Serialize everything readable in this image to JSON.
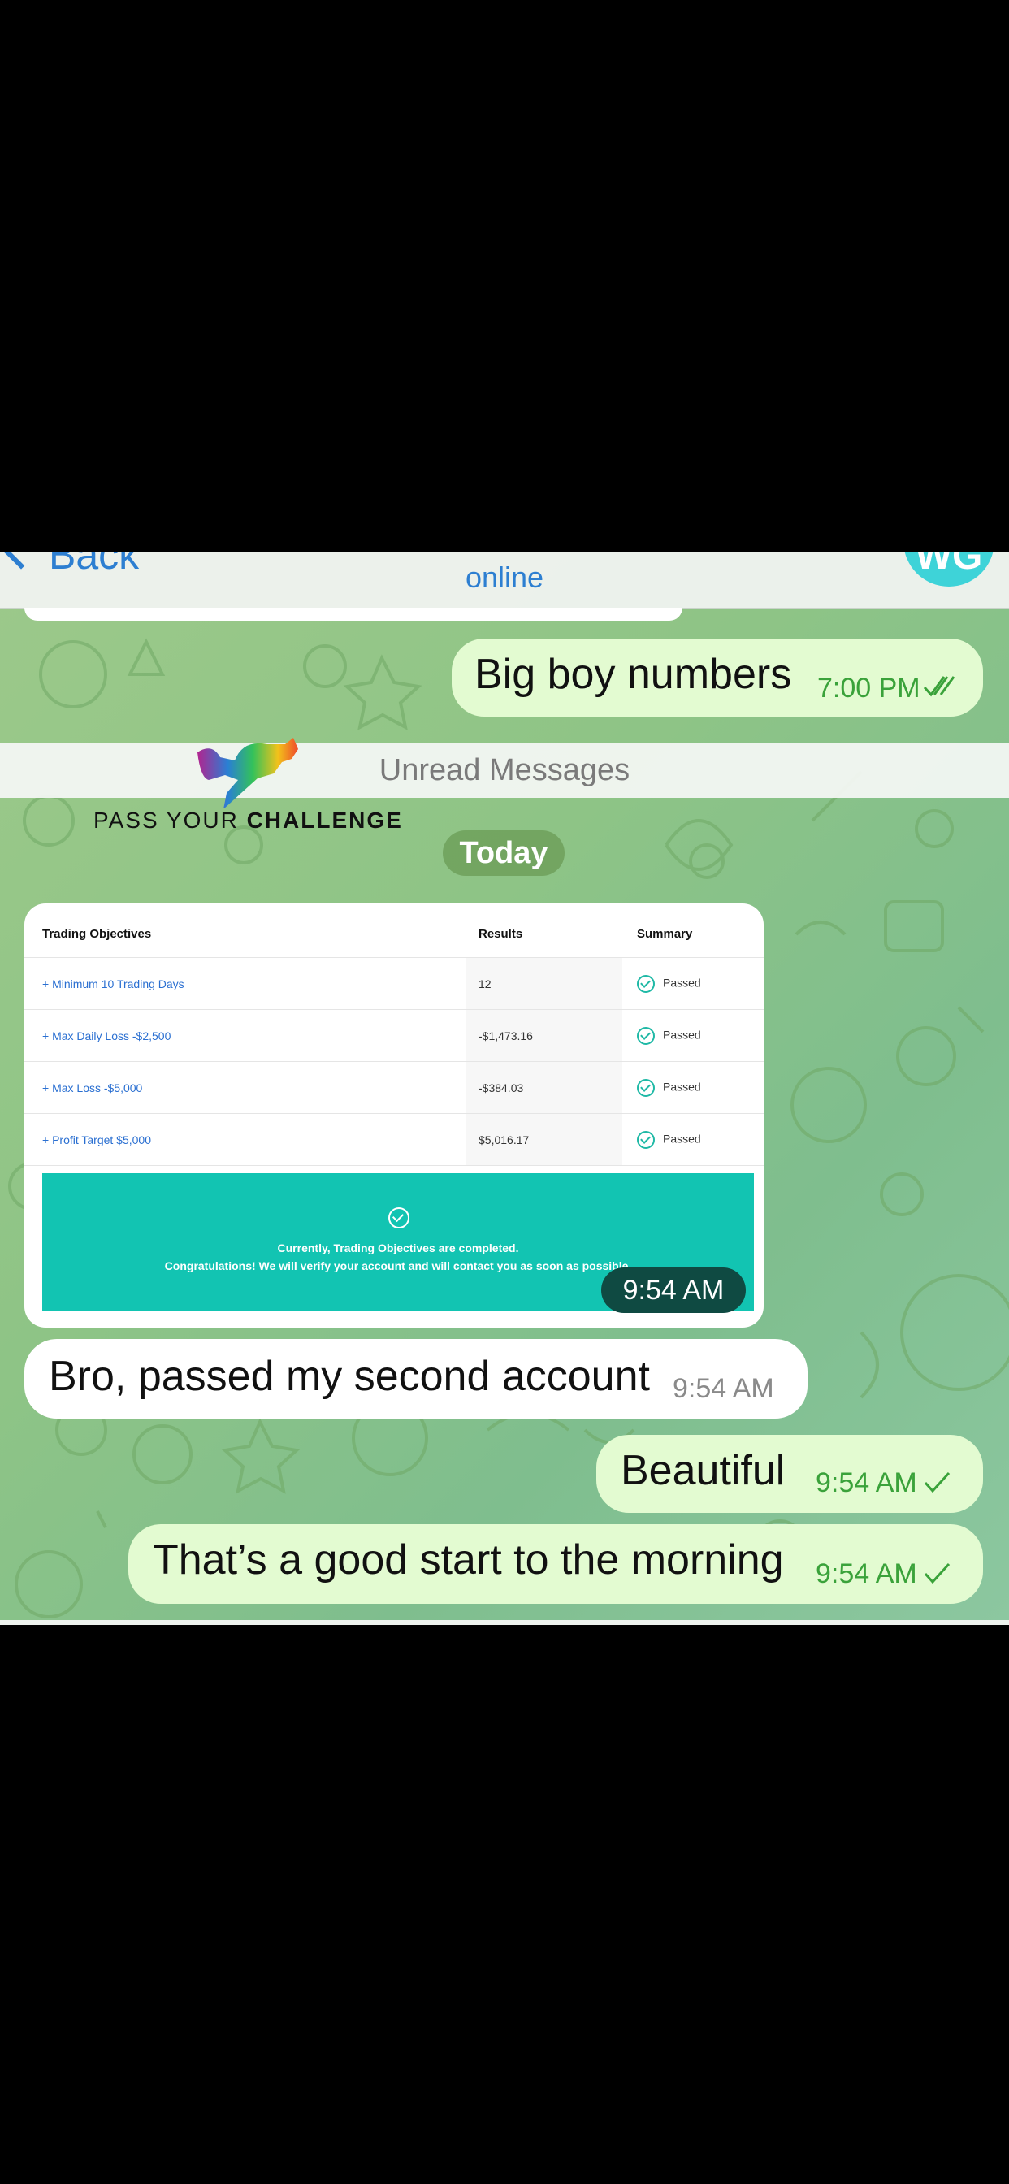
{
  "header": {
    "back_label": "Back",
    "status": "online",
    "avatar_initials": "WG"
  },
  "messages": {
    "m1": {
      "text": "Big boy numbers",
      "time": "7:00 PM",
      "status_icon": "double-check-icon"
    },
    "unread_label": "Unread Messages",
    "date_label": "Today",
    "image_time": "9:54 AM",
    "m2": {
      "text": "Bro, passed my second account",
      "time": "9:54 AM"
    },
    "m3": {
      "text": "Beautiful",
      "time": "9:54 AM",
      "status_icon": "check-icon"
    },
    "m4": {
      "text": "That’s a good start to the morning",
      "time": "9:54 AM",
      "status_icon": "check-icon"
    }
  },
  "logo": {
    "text_light": "PASS YOUR ",
    "text_bold": "CHALLENGE"
  },
  "trading_card": {
    "headers": {
      "objective": "Trading Objectives",
      "results": "Results",
      "summary": "Summary"
    },
    "rows": [
      {
        "objective": "+ Minimum 10 Trading Days",
        "result": "12",
        "summary": "Passed"
      },
      {
        "objective": "+ Max Daily Loss -$2,500",
        "result": "-$1,473.16",
        "summary": "Passed"
      },
      {
        "objective": "+ Max Loss -$5,000",
        "result": "-$384.03",
        "summary": "Passed"
      },
      {
        "objective": "+ Profit Target $5,000",
        "result": "$5,016.17",
        "summary": "Passed"
      }
    ],
    "banner_line1": "Currently, Trading Objectives are completed.",
    "banner_line2": "Congratulations! We will verify your account and will contact you as soon as possible."
  },
  "colors": {
    "outgoing_bubble": "#e3fbd1",
    "incoming_bubble": "#ffffff",
    "link_blue": "#2d7fd1",
    "banner_teal": "#12c4b2"
  }
}
